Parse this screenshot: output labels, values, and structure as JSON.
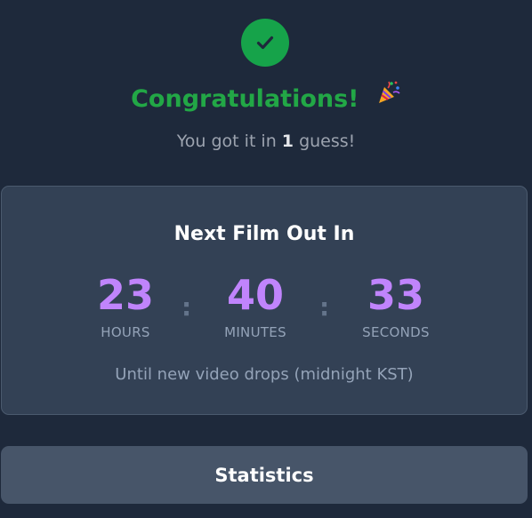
{
  "result": {
    "check_icon": "check-circle-icon",
    "success_color": "#16a34a",
    "title": "Congratulations!",
    "celebrate_icon": "party-popper-icon",
    "subtitle_prefix": "You got it in ",
    "guess_count": "1",
    "subtitle_suffix": " guess!"
  },
  "countdown": {
    "heading": "Next Film Out In",
    "hours": "23",
    "hours_label": "HOURS",
    "minutes": "40",
    "minutes_label": "MINUTES",
    "seconds": "33",
    "seconds_label": "SECONDS",
    "separator": ":",
    "accent_color": "#c084fc",
    "note": "Until new video drops (midnight KST)"
  },
  "actions": {
    "statistics_label": "Statistics"
  }
}
